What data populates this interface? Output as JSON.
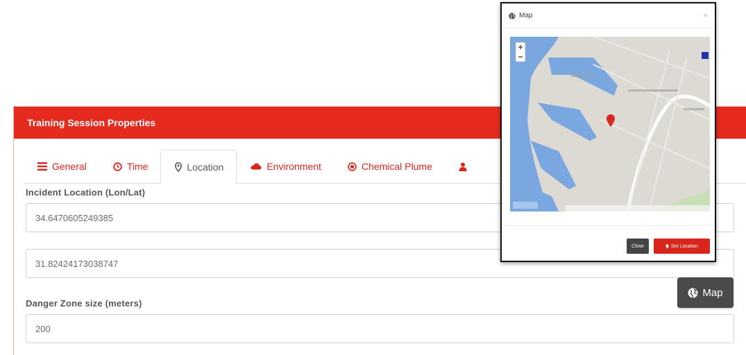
{
  "panel": {
    "title": "Training Session Properties"
  },
  "tabs": [
    {
      "label": "General",
      "icon": "list-icon"
    },
    {
      "label": "Time",
      "icon": "clock-icon"
    },
    {
      "label": "Location",
      "icon": "map-marker-icon"
    },
    {
      "label": "Environment",
      "icon": "cloud-icon"
    },
    {
      "label": "Chemical Plume",
      "icon": "target-icon"
    }
  ],
  "active_tab": "Location",
  "location": {
    "section_label": "Incident Location (Lon/Lat)",
    "lon_value": "34.6470605249385",
    "lat_value": "31.82424173038747",
    "danger_label": "Danger Zone size (meters)",
    "danger_value": "200",
    "map_button_label": "Map"
  },
  "modal": {
    "title": "Map",
    "close_x": "×",
    "close_button": "Close",
    "set_location_button": "Set Location"
  },
  "colors": {
    "accent": "#e52b1e",
    "map_water": "#7aa7e0",
    "map_land": "#ddd9d3"
  }
}
